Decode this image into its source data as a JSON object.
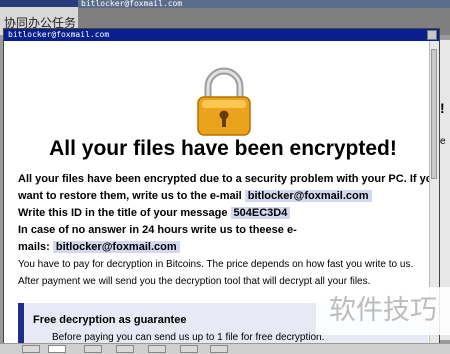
{
  "background": {
    "left_window_text": "协同办公任务",
    "right_window_title": "bitlocker@foxmail.com",
    "right_panel_mark": "!",
    "right_panel_mark2": "e"
  },
  "window": {
    "title": "bitlocker@foxmail.com"
  },
  "content": {
    "headline": "All your files have been encrypted!",
    "line1": "All your files have been encrypted due to a security problem with your PC. If you",
    "line2_prefix": "want to restore them, write us to the e-mail",
    "email": "bitlocker@foxmail.com",
    "line3_prefix": "Write this ID in the title of your message",
    "id": "504EC3D4",
    "line4": "In case of no answer in 24 hours write us to theese e-",
    "line5_prefix": "mails:",
    "email2": "bitlocker@foxmail.com",
    "line6": "You have to pay for decryption in Bitcoins. The price depends on how fast you write to us.",
    "line7": "After payment we will send you the decryption tool that will decrypt all your files.",
    "guarantee_title": "Free decryption as guarantee",
    "guarantee_text": "Before paying you can send us up to 1 file for free decryption."
  },
  "watermark": "软件技巧",
  "colors": {
    "titlebar": "#0a1f8f",
    "highlight": "#d3d8ef",
    "guarantee_bar": "#1f2d86",
    "lock_gold": "#e9a31c"
  }
}
